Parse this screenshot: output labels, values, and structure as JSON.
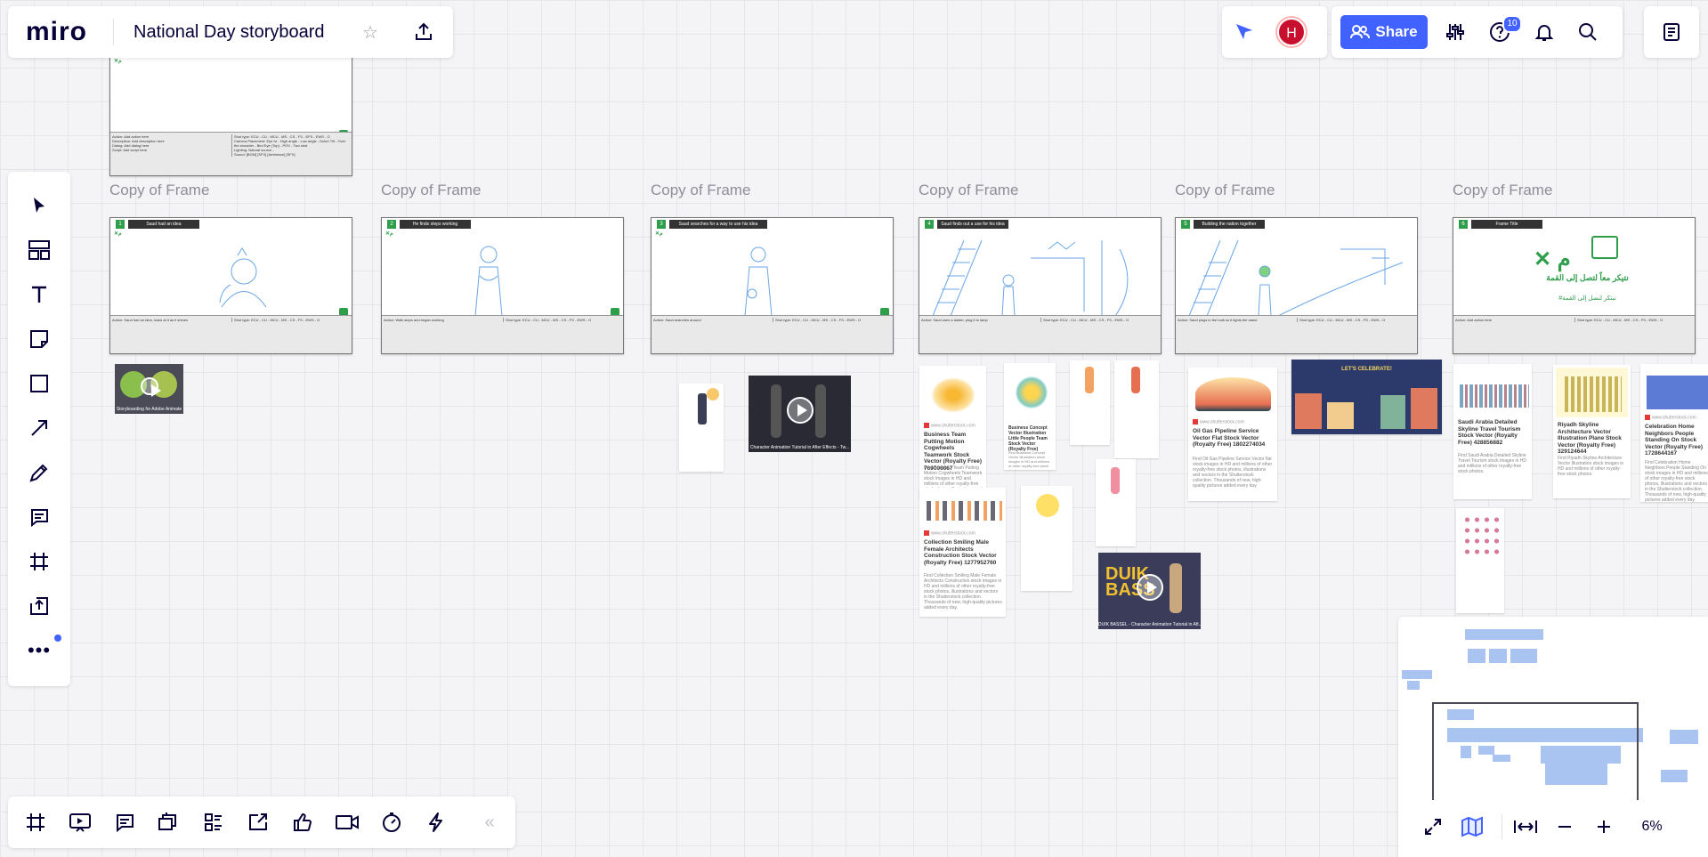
{
  "app": {
    "logo": "miro",
    "board_title": "National Day storyboard"
  },
  "topbar": {
    "share_label": "Share",
    "notifications_count": "10",
    "avatar_initial": "H"
  },
  "colors": {
    "accent": "#4262ff",
    "avatar": "#c8102e",
    "badge": "#4262ff",
    "green": "#2e9e4b"
  },
  "left_toolbar": {
    "tools": [
      "select-icon",
      "templates-icon",
      "text-icon",
      "sticky-note-icon",
      "shape-icon",
      "arrow-icon",
      "pen-icon",
      "comment-icon",
      "frame-icon",
      "upload-icon",
      "more-icon"
    ]
  },
  "bottom_toolbar": {
    "tools": [
      "frames-icon",
      "presentation-icon",
      "comments-icon",
      "cards-icon",
      "kanban-icon",
      "share-screen-icon",
      "voting-icon",
      "video-icon",
      "timer-icon",
      "lightning-icon"
    ],
    "collapse_label": "«"
  },
  "zoom": {
    "level": "6%"
  },
  "frames": {
    "top_frame": {
      "notes": [
        "Action: Add action here",
        "Description: Add description here",
        "Dialog: Add dialog here",
        "Script: Add script here"
      ],
      "shot": [
        "Shot type: ECU - CU - MCU - MS - CS - FS - EFS - EWS - O",
        "Camera Placement: Eye lvl - High angle - Low angle - Dutch Tilt - Over the shoulder - Bird Eye (Top) - POV - Two shot",
        "Lighting: Natural source -",
        "Sound: [BGM] [SFX] [Ambience] [SFX]"
      ]
    },
    "copy_label": "Copy of Frame",
    "items": [
      {
        "num": "1",
        "header": "Saud had an idea",
        "note": "Action: Saud had an idea, looks at it as it shines",
        "shot": "Shot type: ECU - CU - MCU - MS - CS - FS - EWS - O"
      },
      {
        "num": "2",
        "header": "He finds steps working",
        "note": "Action: Walk stops and began working",
        "shot": "Shot type: ECU - CU - MCU - MS - CS - FS - EWS - O"
      },
      {
        "num": "3",
        "header": "Saud searches for a way to use his idea",
        "note": "Action: Saud searches around",
        "shot": "Shot type: ECU - CU - MCU - MS - CS - FS - EWS - O"
      },
      {
        "num": "4",
        "header": "Saud finds out a use for his idea",
        "note": "Action: Saud uses a ladder, plug it to lamp",
        "shot": "Shot type: ECU - CU - MCU - MS - CS - FS - EWS - O"
      },
      {
        "num": "5",
        "header": "Building the nation together",
        "note": "Action: Saud plugs in the bulb so it lights the stand",
        "shot": "Shot type: ECU - CU - MCU - MS - CS - FS - EWS - O"
      },
      {
        "num": "6",
        "header": "Frame Title",
        "note": "Action: Add action here",
        "shot": "Shot type: ECU - CU - MCU - MS - CS - FS - EWS - O",
        "arabic_line1": "نتيكر معاً لتصل إلى القمة",
        "arabic_line2": "#نبتكر لنصل إلى القمة"
      }
    ]
  },
  "cards": [
    {
      "title": "Business Team Putting Motion Cogwheels Teamwork Stock Vector (Royalty Free) 769006067",
      "source": "www.shutterstock.com",
      "text": "Find Business Team Putting Motion Cogwheels Teamwork stock images in HD and millions of other royalty-free stock photos, illustrations and vectors in the Shutterstock collection."
    },
    {
      "title": "Business Concept Vector Illustration Little People Team Stock Vector (Royalty Free)",
      "source": "www.shutterstock.com",
      "text": "Find Business Concept Vector Illustration stock images in HD and millions of other royalty-free stock photos."
    },
    {
      "title": "Collection Smiling Male Female Architects Construction Stock Vector (Royalty Free) 1277952760",
      "source": "www.shutterstock.com",
      "text": "Find Collection Smiling Male Female Architects Construction stock images in HD and millions of other royalty-free stock photos, illustrations and vectors in the Shutterstock collection. Thousands of new, high-quality pictures added every day."
    },
    {
      "title": "Oil Gas Pipeline Service Vector Flat Stock Vector (Royalty Free) 1802274034",
      "source": "www.shutterstock.com",
      "text": "Find Oil Gas Pipeline Service Vector flat stock images in HD and millions of other royalty-free stock photos, illustrations and vectors in the Shutterstock collection. Thousands of new, high-quality pictures added every day."
    },
    {
      "title": "Saudi Arabia Detailed Skyline Travel Tourism Stock Vector (Royalty Free) 428856882",
      "source": "www.shutterstock.com",
      "text": "Find Saudi Arabia Detailed Skyline Travel Tourism stock images in HD and millions of other royalty-free stock photos."
    },
    {
      "title": "Riyadh Skyline Architecture Vector Illustration Plane Stock Vector (Royalty Free) 329124644",
      "source": "www.shutterstock.com",
      "text": "Find Riyadh Skyline Architecture Vector Illustration stock images in HD and millions of other royalty-free stock photos."
    },
    {
      "title": "Celebration Home Neighbors People Standing On Stock Vector (Royalty Free) 1728644167",
      "source": "www.shutterstock.com",
      "text": "Find Celebration Home Neighbors People Standing On stock images in HD and millions of other royalty-free stock photos, illustrations and vectors in the Shutterstock collection. Thousands of new, high-quality pictures added every day."
    }
  ],
  "videos": [
    {
      "caption": "Storyboarding for Adobe Animate"
    },
    {
      "caption": "Character Animation Tutorial in After Effects - Tw..."
    },
    {
      "caption": "DUIK BASSEL - Character Animation Tutorial in Aft..."
    }
  ],
  "banner": {
    "text": "LET'S CELEBRATE!"
  }
}
